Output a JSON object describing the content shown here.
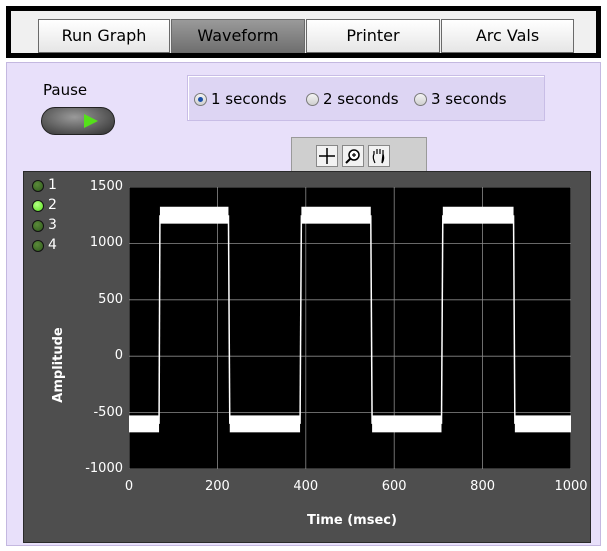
{
  "tabs": [
    {
      "label": "Run Graph",
      "active": false
    },
    {
      "label": "Waveform",
      "active": true
    },
    {
      "label": "Printer",
      "active": false
    },
    {
      "label": "Arc Vals",
      "active": false
    }
  ],
  "pause": {
    "label": "Pause",
    "indicator_color": "#55e01a"
  },
  "duration_options": [
    {
      "label": "1 seconds",
      "selected": true
    },
    {
      "label": "2 seconds",
      "selected": false
    },
    {
      "label": "3 seconds",
      "selected": false
    }
  ],
  "graph_palette": {
    "icons": [
      "crosshair-icon",
      "zoom-icon",
      "pan-hand-icon"
    ]
  },
  "legend": [
    {
      "label": "1",
      "active": false
    },
    {
      "label": "2",
      "active": true
    },
    {
      "label": "3",
      "active": false
    },
    {
      "label": "4",
      "active": false
    }
  ],
  "chart_data": {
    "type": "line",
    "title": "",
    "xlabel": "Time (msec)",
    "ylabel": "Amplitude",
    "xlim": [
      0,
      1000
    ],
    "ylim": [
      -1000,
      1500
    ],
    "x_ticks": [
      "0",
      "200",
      "400",
      "600",
      "800",
      "1000"
    ],
    "y_ticks": [
      "1500",
      "1000",
      "500",
      "0",
      "-500",
      "-1000"
    ],
    "grid": true,
    "series": [
      {
        "name": "2",
        "color": "#ffffff",
        "x": [
          0,
          68,
          70,
          225,
          228,
          387,
          390,
          547,
          550,
          707,
          710,
          870,
          873,
          1000
        ],
        "y": [
          -600,
          -600,
          1250,
          1250,
          -600,
          -600,
          1250,
          1250,
          -600,
          -600,
          1250,
          1250,
          -600,
          -600
        ],
        "noise_band": 150
      }
    ]
  },
  "colors": {
    "panel_bg": "#e8e0fa",
    "plot_bg": "#000000",
    "trace": "#ffffff",
    "led_on": "#55e01a",
    "led_off": "#2f5a1c"
  }
}
